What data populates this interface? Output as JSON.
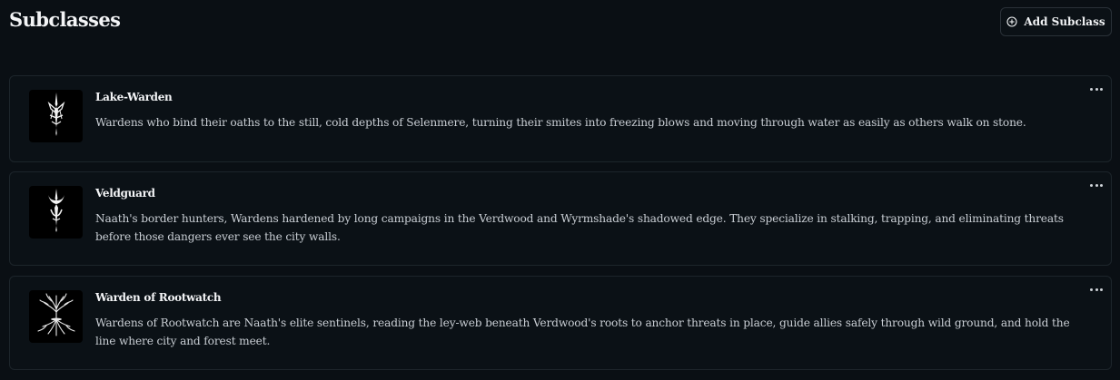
{
  "header": {
    "title": "Subclasses",
    "add_button_label": "Add Subclass",
    "add_button_icon": "plus-circle-icon"
  },
  "subclasses": [
    {
      "name": "Lake-Warden",
      "icon": "lake-warden-sigil-icon",
      "description": "Wardens who bind their oaths to the still, cold depths of Selenmere, turning their smites into freezing blows and moving through water as easily as others walk on stone."
    },
    {
      "name": "Veldguard",
      "icon": "veldguard-sigil-icon",
      "description": "Naath's border hunters, Wardens hardened by long campaigns in the Verdwood and Wyrmshade's shadowed edge. They specialize in stalking, trapping, and eliminating threats before those dangers ever see the city walls."
    },
    {
      "name": "Warden of Rootwatch",
      "icon": "tree-roots-sigil-icon",
      "description": "Wardens of Rootwatch are Naath's elite sentinels, reading the ley-web beneath Verdwood's roots to anchor threats in place, guide allies safely through wild ground, and hold the line where city and forest meet."
    }
  ]
}
